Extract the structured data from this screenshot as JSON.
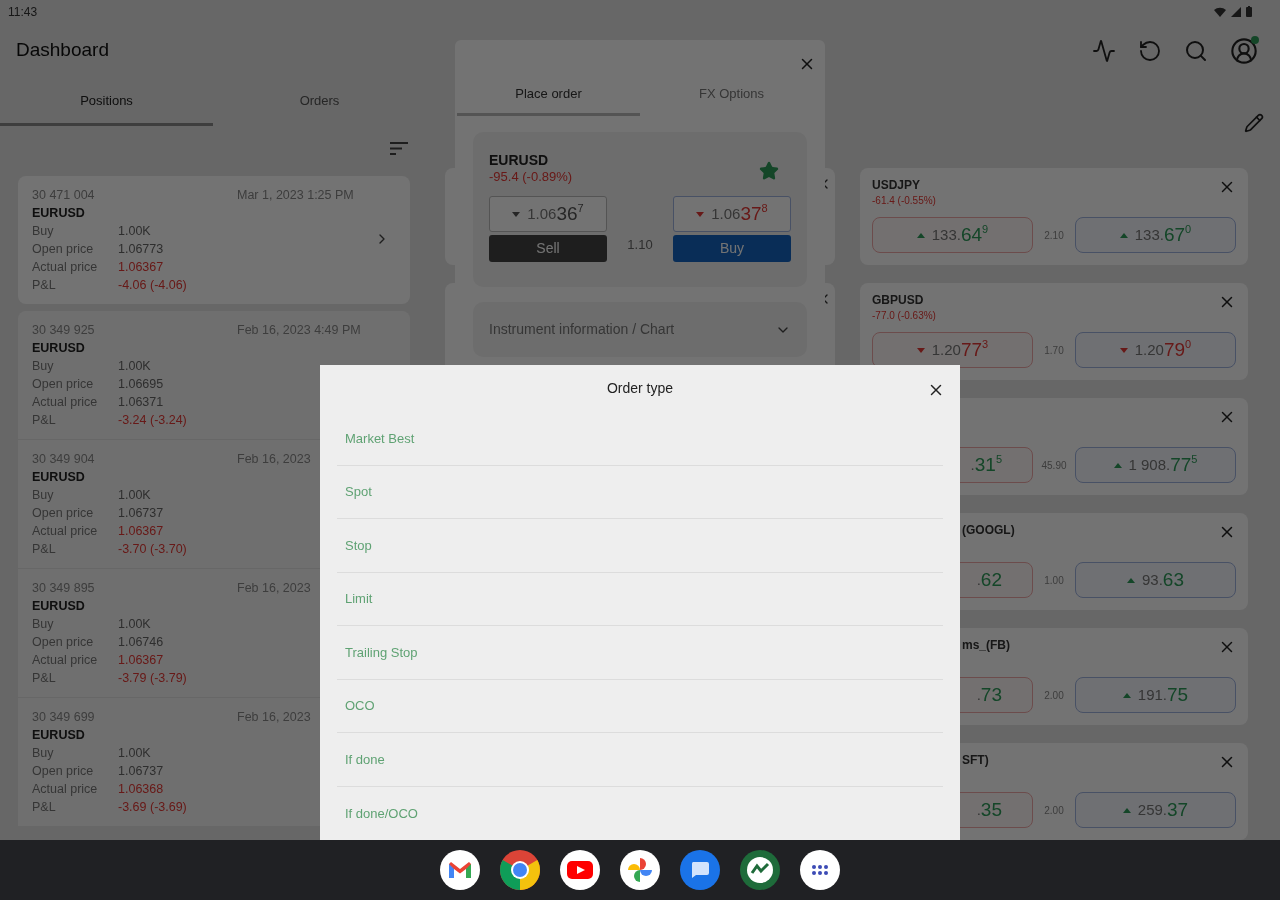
{
  "status_bar": {
    "time": "11:43"
  },
  "app_bar": {
    "title": "Dashboard",
    "account_badge": true
  },
  "left_tabs": [
    {
      "label": "Positions",
      "selected": true
    },
    {
      "label": "Orders",
      "selected": false
    }
  ],
  "positions": [
    {
      "id": "30 471 004",
      "date": "Mar 1, 2023 1:25 PM",
      "symbol": "EURUSD",
      "selected": true,
      "fields": [
        {
          "label": "Buy",
          "value": "1.00K",
          "negative": false
        },
        {
          "label": "Open price",
          "value": "1.06773",
          "negative": false
        },
        {
          "label": "Actual price",
          "value": "1.06367",
          "negative": true
        },
        {
          "label": "P&L",
          "value": "-4.06 (-4.06)",
          "negative": true
        }
      ]
    },
    {
      "id": "30 349 925",
      "date": "Feb 16, 2023 4:49 PM",
      "symbol": "EURUSD",
      "selected": false,
      "fields": [
        {
          "label": "Buy",
          "value": "1.00K",
          "negative": false
        },
        {
          "label": "Open price",
          "value": "1.06695",
          "negative": false
        },
        {
          "label": "Actual price",
          "value": "1.06371",
          "negative": false
        },
        {
          "label": "P&L",
          "value": "-3.24 (-3.24)",
          "negative": true
        }
      ]
    },
    {
      "id": "30 349 904",
      "date": "Feb 16, 2023",
      "symbol": "EURUSD",
      "selected": false,
      "fields": [
        {
          "label": "Buy",
          "value": "1.00K",
          "negative": false
        },
        {
          "label": "Open price",
          "value": "1.06737",
          "negative": false
        },
        {
          "label": "Actual price",
          "value": "1.06367",
          "negative": true
        },
        {
          "label": "P&L",
          "value": "-3.70 (-3.70)",
          "negative": true
        }
      ]
    },
    {
      "id": "30 349 895",
      "date": "Feb 16, 2023",
      "symbol": "EURUSD",
      "selected": false,
      "fields": [
        {
          "label": "Buy",
          "value": "1.00K",
          "negative": false
        },
        {
          "label": "Open price",
          "value": "1.06746",
          "negative": false
        },
        {
          "label": "Actual price",
          "value": "1.06367",
          "negative": true
        },
        {
          "label": "P&L",
          "value": "-3.79 (-3.79)",
          "negative": true
        }
      ]
    },
    {
      "id": "30 349 699",
      "date": "Feb 16, 2023",
      "symbol": "EURUSD",
      "selected": false,
      "fields": [
        {
          "label": "Buy",
          "value": "1.00K",
          "negative": false
        },
        {
          "label": "Open price",
          "value": "1.06737",
          "negative": false
        },
        {
          "label": "Actual price",
          "value": "1.06368",
          "negative": true
        },
        {
          "label": "P&L",
          "value": "-3.69 (-3.69)",
          "negative": true
        }
      ]
    }
  ],
  "order_panel": {
    "tabs": [
      {
        "label": "Place order",
        "selected": true
      },
      {
        "label": "FX Options",
        "selected": false
      }
    ],
    "instrument": {
      "symbol": "EURUSD",
      "change": "-95.4 (-0.89%)",
      "favorite": true,
      "sell": {
        "arrow": true,
        "rising": false,
        "changed": false,
        "prefix": "1.06",
        "big": "36",
        "pip": "7"
      },
      "spread": "1.10",
      "buy": {
        "arrow": true,
        "rising": false,
        "changed": true,
        "prefix": "1.06",
        "big": "37",
        "pip": "8"
      },
      "sell_label": "Sell",
      "buy_label": "Buy"
    },
    "info_section": {
      "label": "Instrument information / Chart",
      "expanded": false
    }
  },
  "quotes": [
    {
      "kind": "full",
      "symbol": "USDJPY",
      "change": "-61.4 (-0.55%)",
      "sell": {
        "arrow": true,
        "rising": true,
        "changed": true,
        "prefix": "133.",
        "big": "64",
        "pip": "9"
      },
      "spread": "2.10",
      "buy": {
        "arrow": true,
        "rising": true,
        "changed": true,
        "prefix": "133.",
        "big": "67",
        "pip": "0"
      }
    },
    {
      "kind": "full",
      "symbol": "GBPUSD",
      "change": "-77.0 (-0.63%)",
      "sell": {
        "arrow": true,
        "rising": false,
        "changed": true,
        "prefix": "1.20",
        "big": "77",
        "pip": "3"
      },
      "spread": "1.70",
      "buy": {
        "arrow": true,
        "rising": false,
        "changed": true,
        "prefix": "1.20",
        "big": "79",
        "pip": "0"
      }
    },
    {
      "kind": "cut",
      "sell": {
        "arrow": false,
        "rising": true,
        "changed": true,
        "prefix": ".",
        "big": "31",
        "pip": "5"
      },
      "spread": "45.90",
      "buy": {
        "arrow": true,
        "rising": true,
        "changed": true,
        "prefix": "1 908.",
        "big": "77",
        "pip": "5"
      }
    },
    {
      "kind": "cut",
      "symbol": "(GOOGL)",
      "sell": {
        "arrow": false,
        "rising": true,
        "changed": true,
        "prefix": ".",
        "big": "62"
      },
      "spread": "1.00",
      "buy": {
        "arrow": true,
        "rising": true,
        "changed": true,
        "prefix": "93.",
        "big": "63"
      }
    },
    {
      "kind": "cut",
      "symbol": "ms_(FB)",
      "sell": {
        "arrow": false,
        "rising": true,
        "changed": true,
        "prefix": ".",
        "big": "73"
      },
      "spread": "2.00",
      "buy": {
        "arrow": true,
        "rising": true,
        "changed": true,
        "prefix": "191.",
        "big": "75"
      }
    },
    {
      "kind": "cut",
      "symbol": "SFT)",
      "sell": {
        "arrow": false,
        "rising": true,
        "changed": true,
        "prefix": ".",
        "big": "35"
      },
      "spread": "2.00",
      "buy": {
        "arrow": true,
        "rising": true,
        "changed": true,
        "prefix": "259.",
        "big": "37"
      }
    }
  ],
  "dialog": {
    "title": "Order type",
    "options": [
      "Market Best",
      "Spot",
      "Stop",
      "Limit",
      "Trailing Stop",
      "OCO",
      "If done",
      "If done/OCO"
    ]
  },
  "taskbar": {
    "apps": [
      {
        "kind": "mail"
      },
      {
        "kind": "browser"
      },
      {
        "kind": "video"
      },
      {
        "kind": "photos"
      },
      {
        "kind": "messages"
      },
      {
        "kind": "fx"
      },
      {
        "kind": "launcher"
      }
    ]
  }
}
